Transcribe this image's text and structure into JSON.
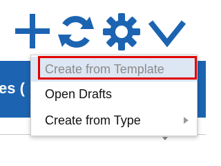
{
  "toolbar": {
    "icons": [
      "plus-icon",
      "refresh-icon",
      "gear-icon",
      "chevron-down-icon"
    ],
    "icon_color": "#1c64b1"
  },
  "header": {
    "partial_text": "es ("
  },
  "menu": {
    "items": [
      {
        "label": "Create from Template",
        "state": "highlighted"
      },
      {
        "label": "Open Drafts"
      },
      {
        "label": "Create from Type",
        "has_submenu": true
      }
    ]
  },
  "annotation": {
    "color": "#e00000"
  }
}
